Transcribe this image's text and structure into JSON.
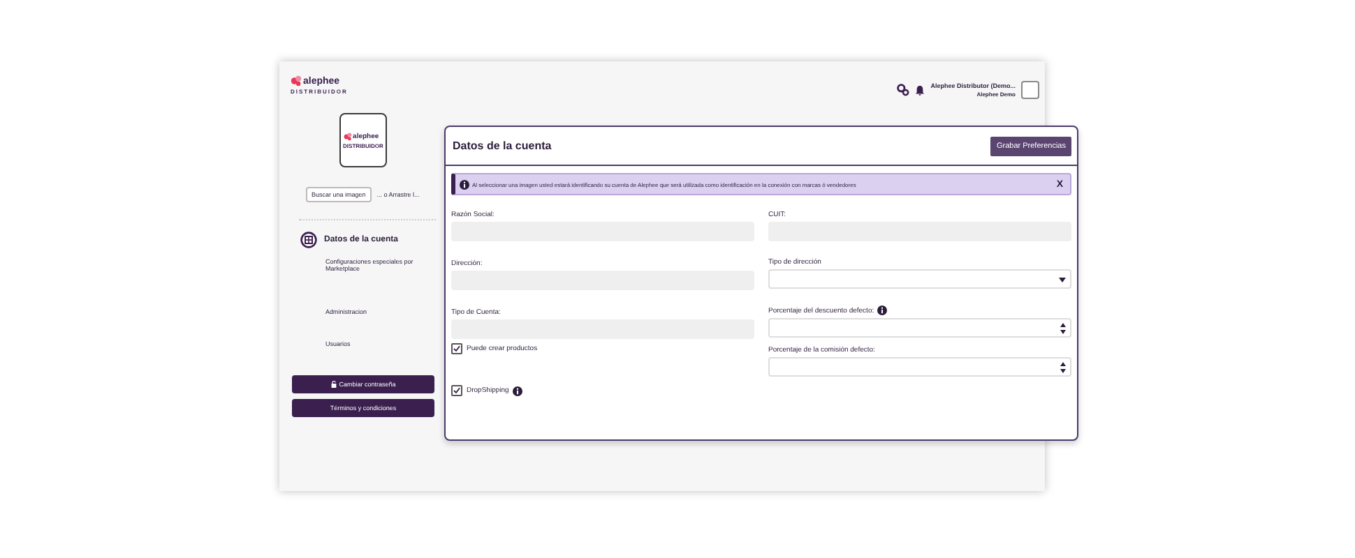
{
  "brand": {
    "name": "alephee",
    "tagline": "DISTRIBUIDOR"
  },
  "header": {
    "user_name": "Alephee Distributor (Demo...",
    "user_company": "Alephee Demo"
  },
  "profile_image": {
    "brand_name": "alephee",
    "brand_tagline": "DISTRIBUIDOR",
    "upload_button": "Buscar una imagen",
    "drop_hint": "... o Arrastre l..."
  },
  "nav": [
    {
      "label": "Datos de la cuenta",
      "selected": true
    },
    {
      "label": "Configuraciones especiales por Marketplace",
      "selected": false
    },
    {
      "label": "Administracion",
      "selected": false
    },
    {
      "label": "Usuarios",
      "selected": false
    }
  ],
  "actions": [
    {
      "label": "Cambiar contraseña",
      "kind": "lock"
    },
    {
      "label": "Términos y condiciones",
      "kind": "plain"
    }
  ],
  "panel": {
    "title": "Datos de la cuenta",
    "save_button": "Grabar Preferencias",
    "notice": {
      "text": "Al seleccionar una imagen usted estará identificando su cuenta de Alephee que será utilizada como identificación en la conexión con marcas ó vendedores",
      "close": "X"
    },
    "left_fields": [
      {
        "kind": "text",
        "label": "Razón Social:",
        "disabled": true
      },
      {
        "kind": "text",
        "label": "Dirección:",
        "disabled": true
      },
      {
        "kind": "text",
        "label": "Tipo de Cuenta:",
        "disabled": true
      },
      {
        "kind": "checkbox",
        "label": "Puede crear productos",
        "checked": true,
        "info": false
      },
      {
        "kind": "checkbox",
        "label": "DropShipping",
        "checked": true,
        "info": true
      }
    ],
    "right_fields": [
      {
        "kind": "text",
        "label": "CUIT:",
        "disabled": true
      },
      {
        "kind": "select",
        "label": "Tipo de dirección"
      },
      {
        "kind": "number",
        "label": "Porcentaje del descuento defecto:",
        "info": true
      },
      {
        "kind": "number",
        "label": "Porcentaje de la comisión defecto:",
        "info": false
      }
    ]
  }
}
